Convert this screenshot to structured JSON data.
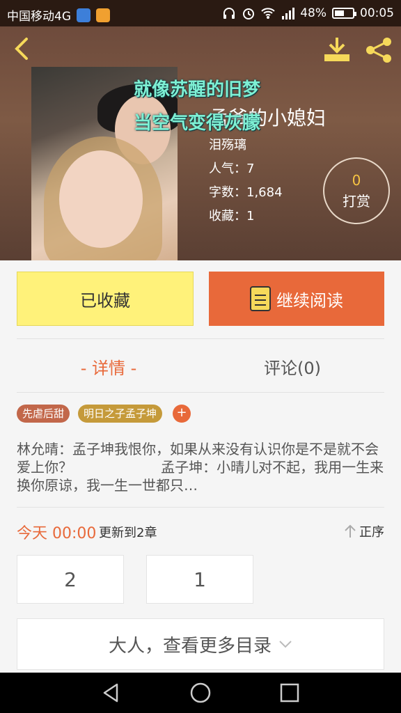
{
  "status_bar": {
    "carrier": "中国移动4G",
    "battery_percent": "48%",
    "time": "00:05",
    "icons": [
      "app-k-icon",
      "app-orange-icon",
      "headphones-icon",
      "alarm-icon",
      "wifi-icon",
      "signal-icon",
      "battery-icon"
    ]
  },
  "header": {
    "lyric_line1": "就像苏醒的旧梦",
    "lyric_line2": "当空气变得灰朦",
    "title": "孟爷的小媳妇",
    "author": "泪殇璃",
    "popularity": "人气：7",
    "word_count": "字数：1,684",
    "favorites": "收藏：1",
    "tip_count": "0",
    "tip_label": "打赏"
  },
  "actions": {
    "favorited_label": "已收藏",
    "continue_label": "继续阅读"
  },
  "tabs": {
    "detail": "- 详情 -",
    "comments": "评论(0)"
  },
  "tags": [
    "先虐后甜",
    "明日之子孟子坤",
    "+"
  ],
  "summary": "林允晴：孟子坤我恨你，如果从来没有认识你是不是就不会爱上你？                    孟子坤：小晴儿对不起，我用一生来换你原谅，我一生一世都只…",
  "update": {
    "time": "今天 00:00",
    "text": "更新到2章",
    "order_label": "正序"
  },
  "chapters": [
    "2",
    "1"
  ],
  "more_label": "大人，查看更多目录",
  "colors": {
    "accent": "#e8693a",
    "favorite_button": "#fff27a",
    "tip_gold": "#f6c342"
  }
}
